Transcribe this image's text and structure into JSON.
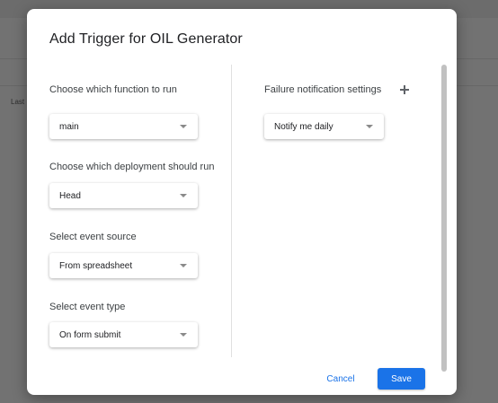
{
  "background": {
    "fragment_text": "Last"
  },
  "dialog": {
    "title": "Add Trigger for OIL Generator",
    "fields": [
      {
        "label": "Choose which function to run",
        "value": "main"
      },
      {
        "label": "Choose which deployment should run",
        "value": "Head"
      },
      {
        "label": "Select event source",
        "value": "From spreadsheet"
      },
      {
        "label": "Select event type",
        "value": "On form submit"
      }
    ],
    "failure": {
      "label": "Failure notification settings",
      "value": "Notify me daily"
    },
    "actions": {
      "cancel": "Cancel",
      "save": "Save"
    }
  },
  "colors": {
    "primary": "#1a73e8",
    "overlay": "#727272"
  },
  "icons": {
    "add": "plus-icon",
    "dropdown": "caret-down-icon"
  }
}
